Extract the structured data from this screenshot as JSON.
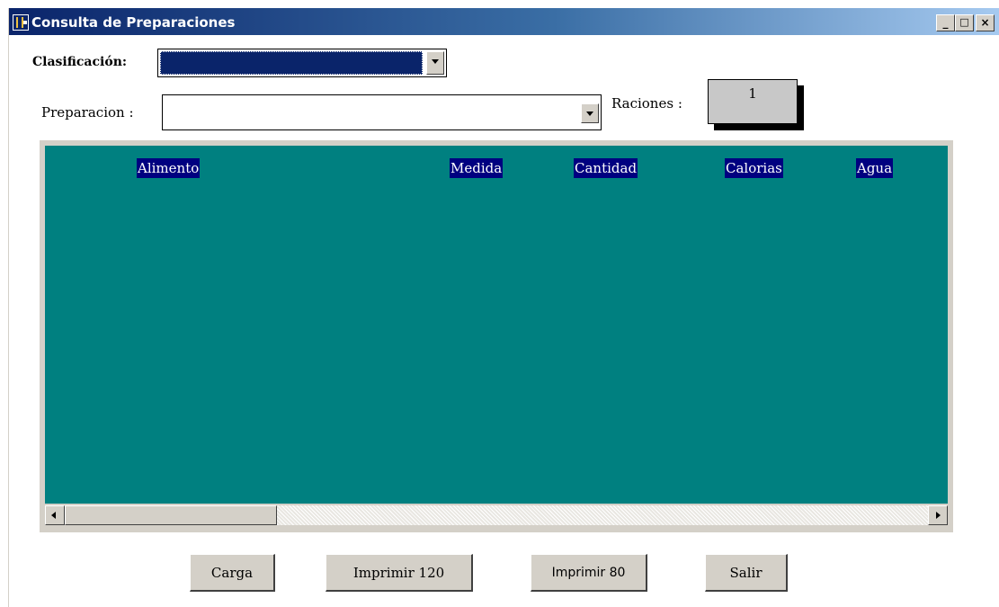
{
  "window": {
    "title": "Consulta de Preparaciones",
    "minimize_glyph": "_",
    "maximize_glyph": "□",
    "close_glyph": "×"
  },
  "form": {
    "clasificacion_label": "Clasificación:",
    "clasificacion_value": "",
    "preparacion_label": "Preparacion :",
    "preparacion_value": "",
    "raciones_label": "Raciones :",
    "raciones_value": "1"
  },
  "grid": {
    "columns": [
      "Alimento",
      "Medida",
      "Cantidad",
      "Calorias",
      "Agua"
    ],
    "rows": []
  },
  "buttons": {
    "carga": "Carga",
    "imprimir120": "Imprimir 120",
    "imprimir80": "Imprimir 80",
    "salir": "Salir"
  },
  "colors": {
    "title_bar": "#0a246a",
    "grid_background": "#008080",
    "header_highlight": "#000080",
    "selected_combo": "#0a246a"
  }
}
